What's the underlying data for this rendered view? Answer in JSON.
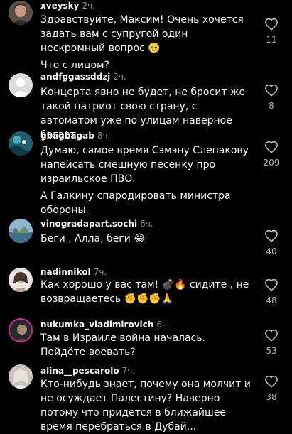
{
  "comments": [
    {
      "username": "xveysky",
      "time": "2ч.",
      "lines": [
        "Здравствуйте, Максим! Очень хочется задать вам с супругой один нескромный вопрос ☺️",
        "Что с лицом?"
      ],
      "likes": "11"
    },
    {
      "username": "andfggassddzj",
      "time": "2ч.",
      "lines": [
        "Концерта явно не будет, не бросит же такой патриот свою страну, с автоматом уже по улицам наверное бегает"
      ],
      "likes": "8"
    },
    {
      "username": "gbagbagab",
      "time": "8ч.",
      "lines": [
        "Думаю, самое время Сэмэну Слепакову напейсать смешную песенку про израильское ПВО.",
        "А Галкину спародировать министра обороны."
      ],
      "likes": "209"
    },
    {
      "username": "vinogradapart.sochi",
      "time": "6ч.",
      "lines": [
        "Беги , Алла, беги 😂"
      ],
      "likes": "40"
    },
    {
      "username": "nadinnikol",
      "time": "7ч.",
      "lines": [
        "Как хорошо у вас там! 💣🔥 сидите , не возвращаетесь ✊✊✊🙏"
      ],
      "likes": "48"
    },
    {
      "username": "nukumka_vladimirovich",
      "time": "6ч.",
      "lines": [
        "Там в Израиле война началась. Пойдёте воевать?"
      ],
      "likes": "53"
    },
    {
      "username": "alina__pescarolo",
      "time": "7ч.",
      "lines": [
        "Кто-нибудь знает, почему она молчит и не осуждает Палестину? Наверно потому что придется в ближайшее время перебраться в Дубай..."
      ],
      "likes": "38"
    }
  ]
}
